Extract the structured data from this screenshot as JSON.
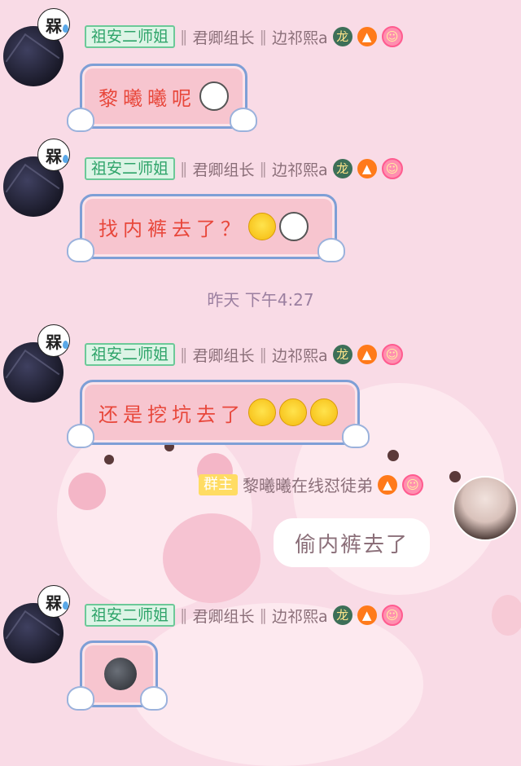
{
  "messages": [
    {
      "badge": "槑",
      "name": "祖安二师姐",
      "title1": "君卿组长",
      "title2": "边祁熙a",
      "text": "黎曦曦呢"
    },
    {
      "badge": "槑",
      "name": "祖安二师姐",
      "title1": "君卿组长",
      "title2": "边祁熙a",
      "text": "找内裤去了？"
    },
    {
      "badge": "槑",
      "name": "祖安二师姐",
      "title1": "君卿组长",
      "title2": "边祁熙a",
      "text": "还是挖坑去了"
    },
    {
      "badge": "槑",
      "name": "祖安二师姐",
      "title1": "君卿组长",
      "title2": "边祁熙a",
      "text": ""
    }
  ],
  "separator": "‖",
  "timestamp": "昨天 下午4:27",
  "owner_message": {
    "tag": "群主",
    "name": "黎曦曦在线怼徒弟",
    "text": "偷内裤去了"
  },
  "icons": {
    "dragon": "dragon-icon",
    "fire": "fire-icon",
    "flower": "flower-badge-icon",
    "moon": "dark-moon-emoji",
    "smile": "smile-emoji",
    "tea": "tea-face-emoji"
  }
}
